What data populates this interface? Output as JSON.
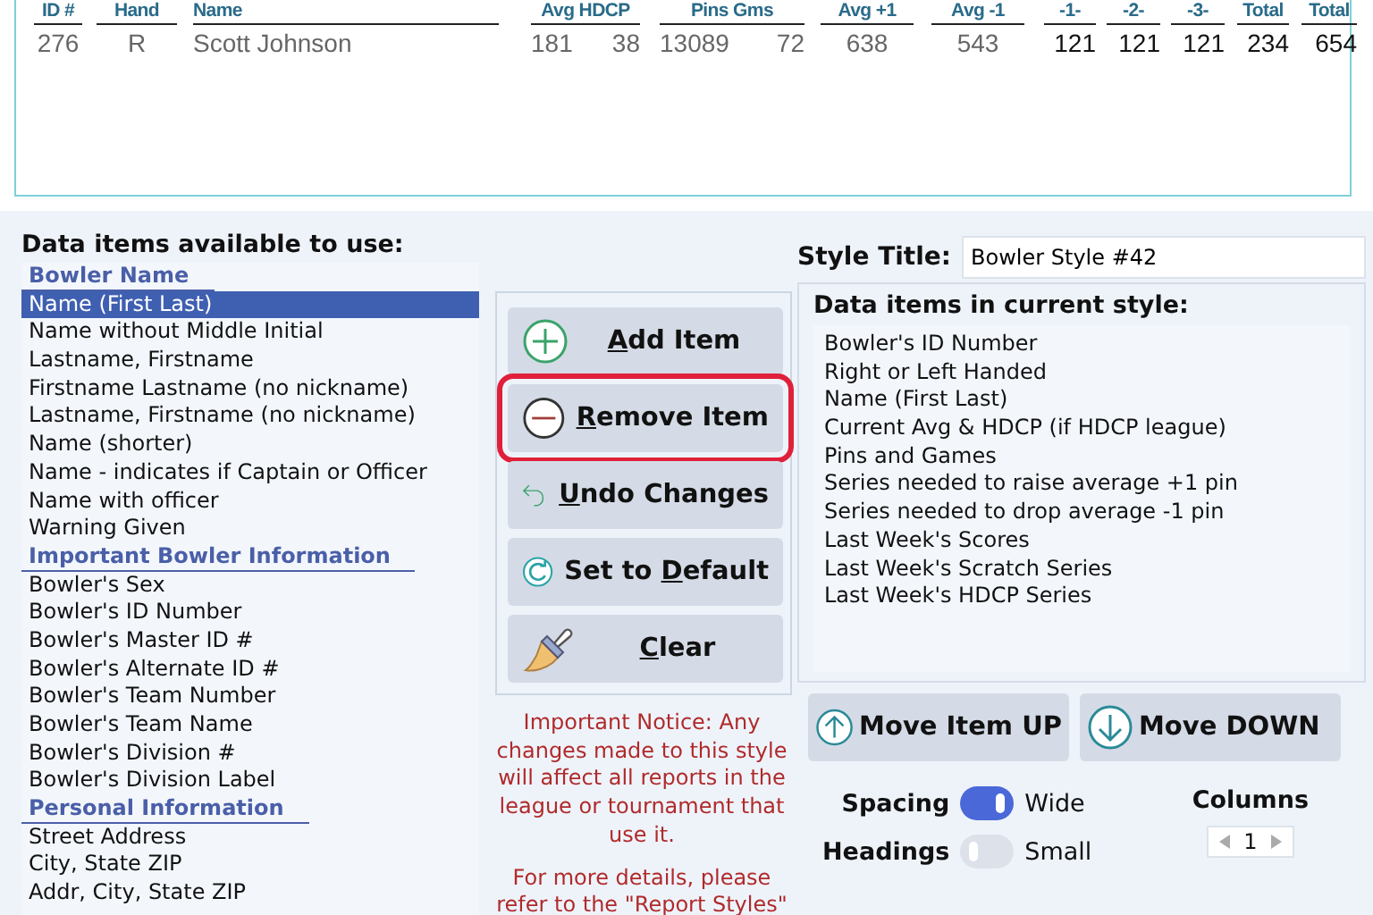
{
  "preview": {
    "columns": [
      {
        "header": "ID #",
        "value": "276",
        "dark": false
      },
      {
        "header": "Hand",
        "value": "R",
        "dark": false
      },
      {
        "header": "Name",
        "value": "Scott Johnson",
        "dark": false
      },
      {
        "header": "Avg HDCP",
        "values": [
          "181",
          "38"
        ],
        "dark": false
      },
      {
        "header": "Pins  Gms",
        "values": [
          "13089",
          "72"
        ],
        "dark": false
      },
      {
        "header": "Avg +1",
        "value": "638",
        "dark": false
      },
      {
        "header": "Avg -1",
        "value": "543",
        "dark": false
      },
      {
        "header": "-1-",
        "value": "121",
        "dark": true
      },
      {
        "header": "-2-",
        "value": "121",
        "dark": true
      },
      {
        "header": "-3-",
        "value": "121",
        "dark": true
      },
      {
        "header": "Total",
        "value": "234",
        "dark": true
      },
      {
        "header": "Total",
        "value": "654",
        "dark": true
      }
    ]
  },
  "available": {
    "title": "Data items available to use:",
    "items": [
      {
        "kind": "header",
        "label": "Bowler Name"
      },
      {
        "kind": "item",
        "label": "Name (First Last)",
        "selected": true
      },
      {
        "kind": "item",
        "label": "Name without Middle Initial",
        "selected": false
      },
      {
        "kind": "item",
        "label": "Lastname, Firstname",
        "selected": false
      },
      {
        "kind": "item",
        "label": "Firstname Lastname (no nickname)",
        "selected": false
      },
      {
        "kind": "item",
        "label": "Lastname, Firstname (no nickname)",
        "selected": false
      },
      {
        "kind": "item",
        "label": "Name (shorter)",
        "selected": false
      },
      {
        "kind": "item",
        "label": "Name - indicates if Captain or Officer",
        "selected": false
      },
      {
        "kind": "item",
        "label": "Name with officer",
        "selected": false
      },
      {
        "kind": "item",
        "label": "Warning Given",
        "selected": false
      },
      {
        "kind": "header",
        "label": "Important Bowler Information"
      },
      {
        "kind": "item",
        "label": "Bowler's Sex",
        "selected": false
      },
      {
        "kind": "item",
        "label": "Bowler's ID Number",
        "selected": false
      },
      {
        "kind": "item",
        "label": "Bowler's Master ID #",
        "selected": false
      },
      {
        "kind": "item",
        "label": "Bowler's Alternate ID #",
        "selected": false
      },
      {
        "kind": "item",
        "label": "Bowler's Team Number",
        "selected": false
      },
      {
        "kind": "item",
        "label": "Bowler's Team Name",
        "selected": false
      },
      {
        "kind": "item",
        "label": "Bowler's Division #",
        "selected": false
      },
      {
        "kind": "item",
        "label": "Bowler's Division Label",
        "selected": false
      },
      {
        "kind": "header",
        "label": "Personal Information"
      },
      {
        "kind": "item",
        "label": "Street Address",
        "selected": false
      },
      {
        "kind": "item",
        "label": "City, State ZIP",
        "selected": false
      },
      {
        "kind": "item",
        "label": "Addr, City, State ZIP",
        "selected": false
      }
    ]
  },
  "actions": [
    {
      "kind": "add",
      "key": "A",
      "post": "dd Item",
      "highlighted": false
    },
    {
      "kind": "remove",
      "key": "R",
      "post": "emove Item",
      "highlighted": true
    },
    {
      "kind": "undo",
      "key": "U",
      "post": "ndo Changes",
      "highlighted": false
    },
    {
      "kind": "default",
      "pre": "Set to ",
      "key": "D",
      "post": "efault",
      "highlighted": false
    },
    {
      "kind": "clear",
      "key": "C",
      "post": "lear",
      "highlighted": false
    }
  ],
  "notice": [
    "Important Notice: Any changes made to this style will affect all reports in the league or tournament that use it.",
    "For more details, please refer to the \"Report Styles\""
  ],
  "style_title": {
    "label": "Style Title:",
    "value": "Bowler Style #42"
  },
  "current": {
    "title": "Data items in current style:",
    "items": [
      "Bowler's ID Number",
      "Right or Left Handed",
      "Name (First Last)",
      "Current Avg & HDCP (if HDCP league)",
      "Pins and Games",
      "Series needed to raise average +1 pin",
      "Series needed to drop average -1 pin",
      "Last Week's Scores",
      "Last Week's Scratch Series",
      "Last Week's HDCP Series"
    ]
  },
  "move": [
    {
      "kind": "up",
      "label": "Move Item UP"
    },
    {
      "kind": "down",
      "label": "Move DOWN"
    }
  ],
  "toggles": [
    {
      "label": "Spacing",
      "on": true,
      "value": "Wide"
    },
    {
      "label": "Headings",
      "on": false,
      "value": "Small"
    }
  ],
  "columns": {
    "label": "Columns",
    "value": "1"
  }
}
